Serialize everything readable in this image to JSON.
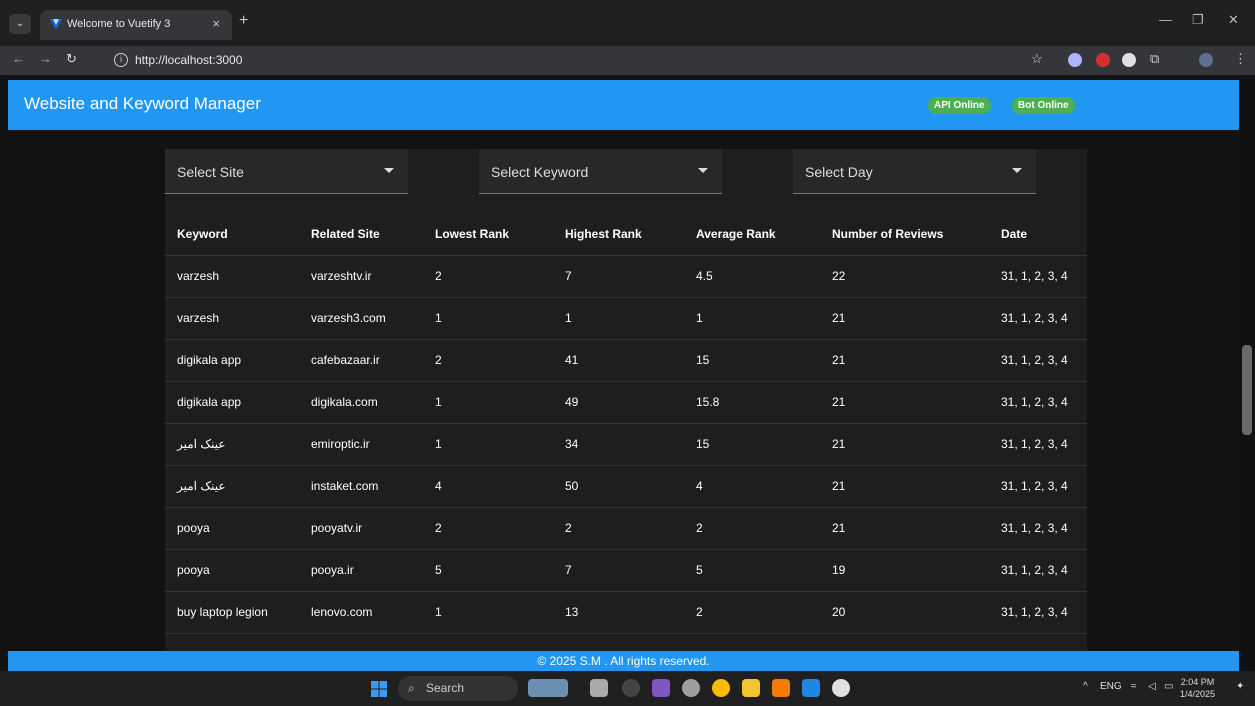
{
  "browser": {
    "tab_title": "Welcome to Vuetify 3",
    "url": "http://localhost:3000"
  },
  "app": {
    "title": "Website and Keyword Manager",
    "status_api": "API Online",
    "status_bot": "Bot Online",
    "colors": {
      "primary": "#2196f3",
      "success": "#4caf50"
    }
  },
  "filters": {
    "site": "Select Site",
    "keyword": "Select Keyword",
    "day": "Select Day"
  },
  "table": {
    "headers": [
      "Keyword",
      "Related Site",
      "Lowest Rank",
      "Highest Rank",
      "Average Rank",
      "Number of Reviews",
      "Date"
    ],
    "rows": [
      [
        "varzesh",
        "varzeshtv.ir",
        "2",
        "7",
        "4.5",
        "22",
        "31, 1, 2, 3, 4"
      ],
      [
        "varzesh",
        "varzesh3.com",
        "1",
        "1",
        "1",
        "21",
        "31, 1, 2, 3, 4"
      ],
      [
        "digikala app",
        "cafebazaar.ir",
        "2",
        "41",
        "15",
        "21",
        "31, 1, 2, 3, 4"
      ],
      [
        "digikala app",
        "digikala.com",
        "1",
        "49",
        "15.8",
        "21",
        "31, 1, 2, 3, 4"
      ],
      [
        "عینک امیر",
        "emiroptic.ir",
        "1",
        "34",
        "15",
        "21",
        "31, 1, 2, 3, 4"
      ],
      [
        "عینک امیر",
        "instaket.com",
        "4",
        "50",
        "4",
        "21",
        "31, 1, 2, 3, 4"
      ],
      [
        "pooya",
        "pooyatv.ir",
        "2",
        "2",
        "2",
        "21",
        "31, 1, 2, 3, 4"
      ],
      [
        "pooya",
        "pooya.ir",
        "5",
        "7",
        "5",
        "19",
        "31, 1, 2, 3, 4"
      ],
      [
        "buy laptop legion",
        "lenovo.com",
        "1",
        "13",
        "2",
        "20",
        "31, 1, 2, 3, 4"
      ]
    ]
  },
  "footer": "© 2025 S.M . All rights reserved.",
  "taskbar": {
    "search": "Search",
    "lang": "ENG",
    "time": "2:04 PM",
    "date": "1/4/2025"
  }
}
